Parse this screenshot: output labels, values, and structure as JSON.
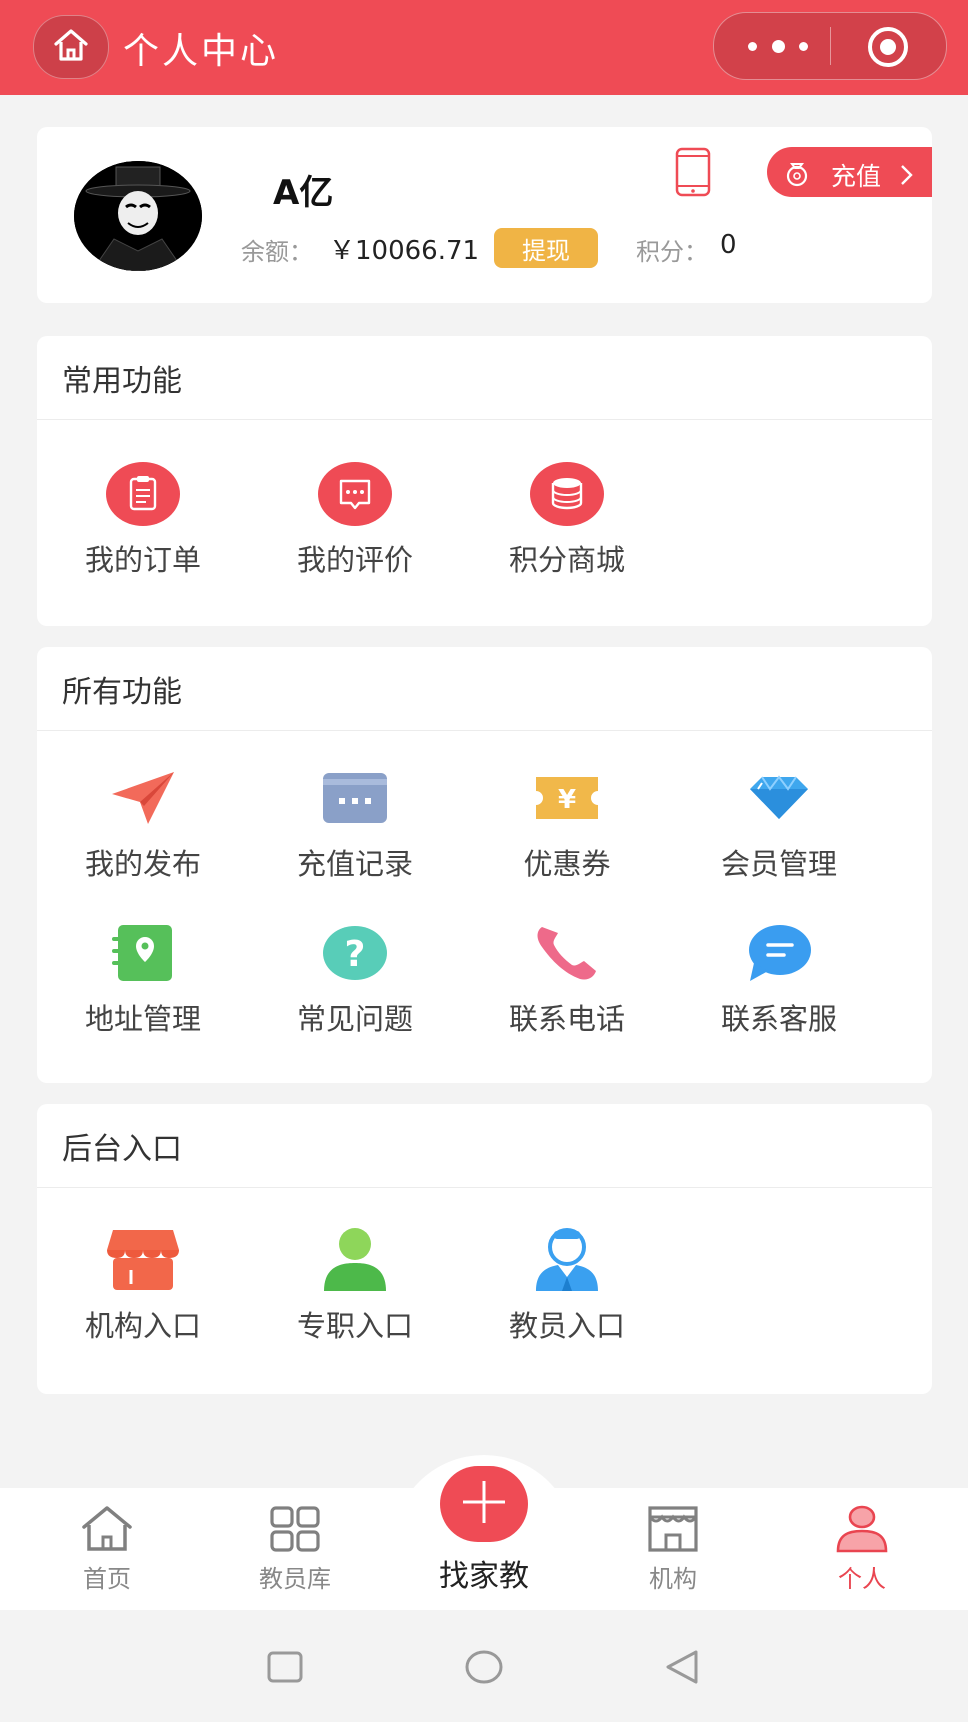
{
  "header": {
    "title": "个人中心",
    "home_icon": "home-icon",
    "more_icon": "more-dots-icon",
    "close_icon": "target-circle-icon",
    "bg_color": "#ef4b55"
  },
  "profile": {
    "username": "A亿",
    "balance_label": "余额：",
    "balance_value": "￥10066.71",
    "withdraw_label": "提现",
    "points_label": "积分：",
    "points_value": "0",
    "recharge_label": "充值"
  },
  "common": {
    "title": "常用功能",
    "items": [
      {
        "label": "我的订单",
        "icon": "order-clipboard-icon"
      },
      {
        "label": "我的评价",
        "icon": "review-message-icon"
      },
      {
        "label": "积分商城",
        "icon": "points-coins-icon"
      }
    ]
  },
  "all_functions": {
    "title": "所有功能",
    "items": [
      {
        "label": "我的发布",
        "icon": "paper-plane-icon"
      },
      {
        "label": "充值记录",
        "icon": "card-icon"
      },
      {
        "label": "优惠券",
        "icon": "coupon-icon"
      },
      {
        "label": "会员管理",
        "icon": "diamond-icon"
      },
      {
        "label": "地址管理",
        "icon": "address-book-icon"
      },
      {
        "label": "常见问题",
        "icon": "question-icon"
      },
      {
        "label": "联系电话",
        "icon": "phone-call-icon"
      },
      {
        "label": "联系客服",
        "icon": "chat-bubble-icon"
      }
    ]
  },
  "backend": {
    "title": "后台入口",
    "items": [
      {
        "label": "机构入口",
        "icon": "shop-icon"
      },
      {
        "label": "专职入口",
        "icon": "person-green-icon"
      },
      {
        "label": "教员入口",
        "icon": "teacher-icon"
      }
    ]
  },
  "bottom_nav": {
    "items": [
      {
        "label": "首页",
        "icon": "home-outline-icon"
      },
      {
        "label": "教员库",
        "icon": "grid-apps-icon"
      },
      {
        "label": "找家教",
        "icon": "plus-icon"
      },
      {
        "label": "机构",
        "icon": "building-icon"
      },
      {
        "label": "个人",
        "icon": "person-icon"
      }
    ],
    "active_color": "#e94550"
  }
}
